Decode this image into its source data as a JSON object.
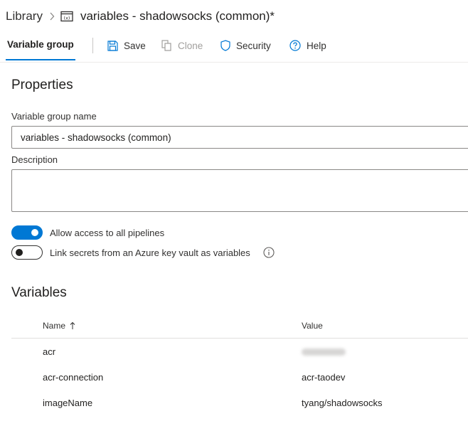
{
  "breadcrumb": {
    "library": "Library",
    "current": "variables - shadowsocks (common)*",
    "icon": "variable-group-icon"
  },
  "toolbar": {
    "tab_label": "Variable group",
    "save": "Save",
    "clone": "Clone",
    "security": "Security",
    "help": "Help"
  },
  "properties": {
    "title": "Properties",
    "name_label": "Variable group name",
    "name_value": "variables - shadowsocks (common)",
    "description_label": "Description",
    "description_value": ""
  },
  "toggles": {
    "allow_access": {
      "label": "Allow access to all pipelines",
      "on": true
    },
    "link_secrets": {
      "label": "Link secrets from an Azure key vault as variables",
      "on": false
    }
  },
  "variables": {
    "title": "Variables",
    "columns": {
      "name": "Name",
      "value": "Value"
    },
    "rows": [
      {
        "name": "acr",
        "value": "",
        "redacted": true
      },
      {
        "name": "acr-connection",
        "value": "acr-taodev"
      },
      {
        "name": "imageName",
        "value": "tyang/shadowsocks"
      }
    ]
  },
  "colors": {
    "accent": "#0078d4",
    "text": "#201f1e",
    "divider": "#edebe9"
  }
}
